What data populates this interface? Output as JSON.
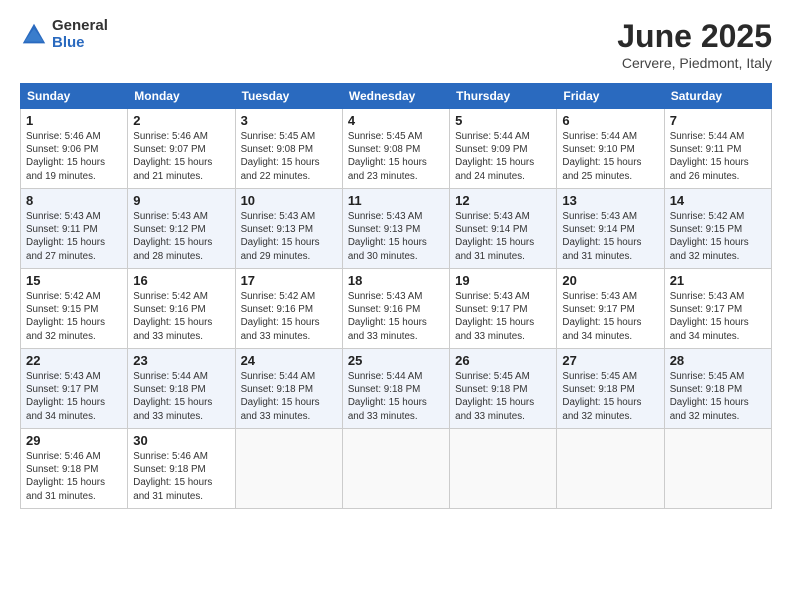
{
  "header": {
    "logo_general": "General",
    "logo_blue": "Blue",
    "month_title": "June 2025",
    "location": "Cervere, Piedmont, Italy"
  },
  "calendar": {
    "columns": [
      "Sunday",
      "Monday",
      "Tuesday",
      "Wednesday",
      "Thursday",
      "Friday",
      "Saturday"
    ],
    "weeks": [
      [
        null,
        {
          "day": "2",
          "sunrise": "Sunrise: 5:46 AM",
          "sunset": "Sunset: 9:07 PM",
          "daylight": "Daylight: 15 hours and 21 minutes."
        },
        {
          "day": "3",
          "sunrise": "Sunrise: 5:45 AM",
          "sunset": "Sunset: 9:08 PM",
          "daylight": "Daylight: 15 hours and 22 minutes."
        },
        {
          "day": "4",
          "sunrise": "Sunrise: 5:45 AM",
          "sunset": "Sunset: 9:08 PM",
          "daylight": "Daylight: 15 hours and 23 minutes."
        },
        {
          "day": "5",
          "sunrise": "Sunrise: 5:44 AM",
          "sunset": "Sunset: 9:09 PM",
          "daylight": "Daylight: 15 hours and 24 minutes."
        },
        {
          "day": "6",
          "sunrise": "Sunrise: 5:44 AM",
          "sunset": "Sunset: 9:10 PM",
          "daylight": "Daylight: 15 hours and 25 minutes."
        },
        {
          "day": "7",
          "sunrise": "Sunrise: 5:44 AM",
          "sunset": "Sunset: 9:11 PM",
          "daylight": "Daylight: 15 hours and 26 minutes."
        }
      ],
      [
        {
          "day": "1",
          "sunrise": "Sunrise: 5:46 AM",
          "sunset": "Sunset: 9:06 PM",
          "daylight": "Daylight: 15 hours and 19 minutes."
        },
        null,
        null,
        null,
        null,
        null,
        null
      ],
      [
        {
          "day": "8",
          "sunrise": "Sunrise: 5:43 AM",
          "sunset": "Sunset: 9:11 PM",
          "daylight": "Daylight: 15 hours and 27 minutes."
        },
        {
          "day": "9",
          "sunrise": "Sunrise: 5:43 AM",
          "sunset": "Sunset: 9:12 PM",
          "daylight": "Daylight: 15 hours and 28 minutes."
        },
        {
          "day": "10",
          "sunrise": "Sunrise: 5:43 AM",
          "sunset": "Sunset: 9:13 PM",
          "daylight": "Daylight: 15 hours and 29 minutes."
        },
        {
          "day": "11",
          "sunrise": "Sunrise: 5:43 AM",
          "sunset": "Sunset: 9:13 PM",
          "daylight": "Daylight: 15 hours and 30 minutes."
        },
        {
          "day": "12",
          "sunrise": "Sunrise: 5:43 AM",
          "sunset": "Sunset: 9:14 PM",
          "daylight": "Daylight: 15 hours and 31 minutes."
        },
        {
          "day": "13",
          "sunrise": "Sunrise: 5:43 AM",
          "sunset": "Sunset: 9:14 PM",
          "daylight": "Daylight: 15 hours and 31 minutes."
        },
        {
          "day": "14",
          "sunrise": "Sunrise: 5:42 AM",
          "sunset": "Sunset: 9:15 PM",
          "daylight": "Daylight: 15 hours and 32 minutes."
        }
      ],
      [
        {
          "day": "15",
          "sunrise": "Sunrise: 5:42 AM",
          "sunset": "Sunset: 9:15 PM",
          "daylight": "Daylight: 15 hours and 32 minutes."
        },
        {
          "day": "16",
          "sunrise": "Sunrise: 5:42 AM",
          "sunset": "Sunset: 9:16 PM",
          "daylight": "Daylight: 15 hours and 33 minutes."
        },
        {
          "day": "17",
          "sunrise": "Sunrise: 5:42 AM",
          "sunset": "Sunset: 9:16 PM",
          "daylight": "Daylight: 15 hours and 33 minutes."
        },
        {
          "day": "18",
          "sunrise": "Sunrise: 5:43 AM",
          "sunset": "Sunset: 9:16 PM",
          "daylight": "Daylight: 15 hours and 33 minutes."
        },
        {
          "day": "19",
          "sunrise": "Sunrise: 5:43 AM",
          "sunset": "Sunset: 9:17 PM",
          "daylight": "Daylight: 15 hours and 33 minutes."
        },
        {
          "day": "20",
          "sunrise": "Sunrise: 5:43 AM",
          "sunset": "Sunset: 9:17 PM",
          "daylight": "Daylight: 15 hours and 34 minutes."
        },
        {
          "day": "21",
          "sunrise": "Sunrise: 5:43 AM",
          "sunset": "Sunset: 9:17 PM",
          "daylight": "Daylight: 15 hours and 34 minutes."
        }
      ],
      [
        {
          "day": "22",
          "sunrise": "Sunrise: 5:43 AM",
          "sunset": "Sunset: 9:17 PM",
          "daylight": "Daylight: 15 hours and 34 minutes."
        },
        {
          "day": "23",
          "sunrise": "Sunrise: 5:44 AM",
          "sunset": "Sunset: 9:18 PM",
          "daylight": "Daylight: 15 hours and 33 minutes."
        },
        {
          "day": "24",
          "sunrise": "Sunrise: 5:44 AM",
          "sunset": "Sunset: 9:18 PM",
          "daylight": "Daylight: 15 hours and 33 minutes."
        },
        {
          "day": "25",
          "sunrise": "Sunrise: 5:44 AM",
          "sunset": "Sunset: 9:18 PM",
          "daylight": "Daylight: 15 hours and 33 minutes."
        },
        {
          "day": "26",
          "sunrise": "Sunrise: 5:45 AM",
          "sunset": "Sunset: 9:18 PM",
          "daylight": "Daylight: 15 hours and 33 minutes."
        },
        {
          "day": "27",
          "sunrise": "Sunrise: 5:45 AM",
          "sunset": "Sunset: 9:18 PM",
          "daylight": "Daylight: 15 hours and 32 minutes."
        },
        {
          "day": "28",
          "sunrise": "Sunrise: 5:45 AM",
          "sunset": "Sunset: 9:18 PM",
          "daylight": "Daylight: 15 hours and 32 minutes."
        }
      ],
      [
        {
          "day": "29",
          "sunrise": "Sunrise: 5:46 AM",
          "sunset": "Sunset: 9:18 PM",
          "daylight": "Daylight: 15 hours and 31 minutes."
        },
        {
          "day": "30",
          "sunrise": "Sunrise: 5:46 AM",
          "sunset": "Sunset: 9:18 PM",
          "daylight": "Daylight: 15 hours and 31 minutes."
        },
        null,
        null,
        null,
        null,
        null
      ]
    ]
  }
}
